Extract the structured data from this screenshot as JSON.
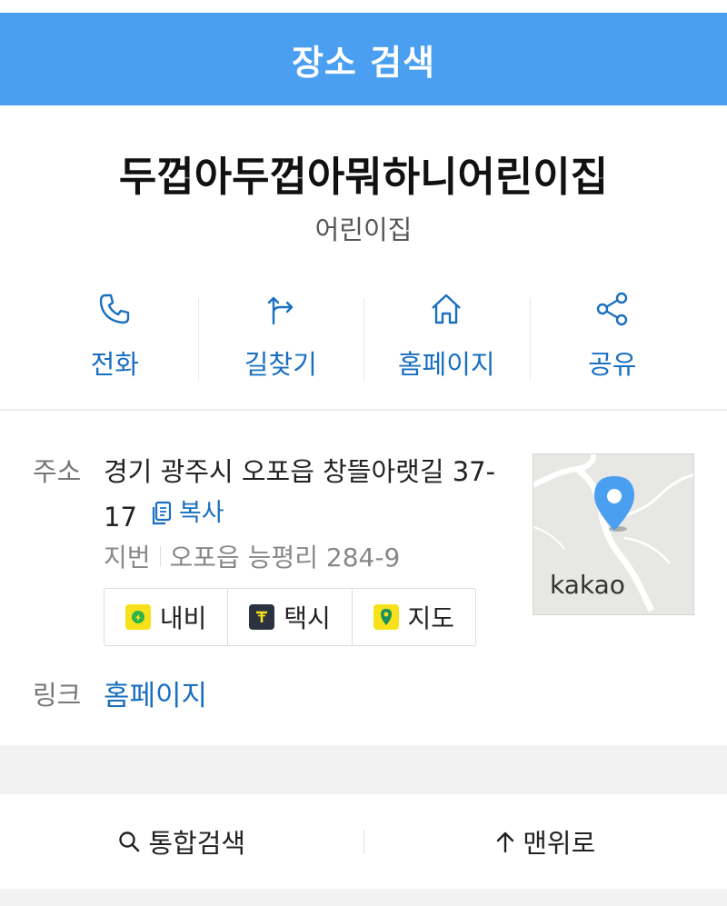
{
  "header": {
    "title": "장소 검색"
  },
  "place": {
    "name": "두껍아두껍아뭐하니어린이집",
    "category": "어린이집"
  },
  "actions": [
    {
      "label": "전화",
      "icon": "phone-icon"
    },
    {
      "label": "길찾기",
      "icon": "directions-icon"
    },
    {
      "label": "홈페이지",
      "icon": "home-icon"
    },
    {
      "label": "공유",
      "icon": "share-icon"
    }
  ],
  "address": {
    "label": "주소",
    "road": "경기 광주시 오포읍 창뜰아랫길 37-17",
    "copy_label": "복사",
    "jibun_label": "지번",
    "jibun": "오포읍 능평리 284-9"
  },
  "nav_buttons": [
    {
      "label": "내비",
      "icon": "navi-icon",
      "color": "#f6e11b"
    },
    {
      "label": "택시",
      "icon": "taxi-icon",
      "color": "#2c3340"
    },
    {
      "label": "지도",
      "icon": "map-pin-icon",
      "color": "#f6e11b"
    }
  ],
  "map": {
    "logo": "kakao",
    "pin_color": "#4a9ff0"
  },
  "link": {
    "label": "링크",
    "value": "홈페이지"
  },
  "footer": {
    "search_label": "통합검색",
    "top_label": "맨위로"
  },
  "colors": {
    "header": "#4a9ff0",
    "accent": "#1a6fc0"
  }
}
